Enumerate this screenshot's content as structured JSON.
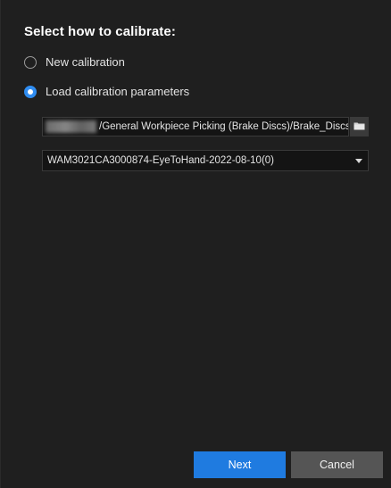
{
  "dialog": {
    "title": "Select how to calibrate:",
    "options": [
      {
        "label": "New calibration",
        "selected": false
      },
      {
        "label": "Load calibration parameters",
        "selected": true
      }
    ],
    "path_field": {
      "value": "/General Workpiece Picking (Brake Discs)/Brake_Discs",
      "browse_icon": "folder-icon"
    },
    "select_field": {
      "value": "WAM3021CA3000874-EyeToHand-2022-08-10(0)",
      "icon": "chevron-down-icon"
    },
    "buttons": {
      "next_label": "Next",
      "cancel_label": "Cancel"
    }
  },
  "colors": {
    "background": "#1f1f1f",
    "accent": "#1f7be0",
    "cancel_bg": "#555555",
    "field_bg": "#141414"
  }
}
